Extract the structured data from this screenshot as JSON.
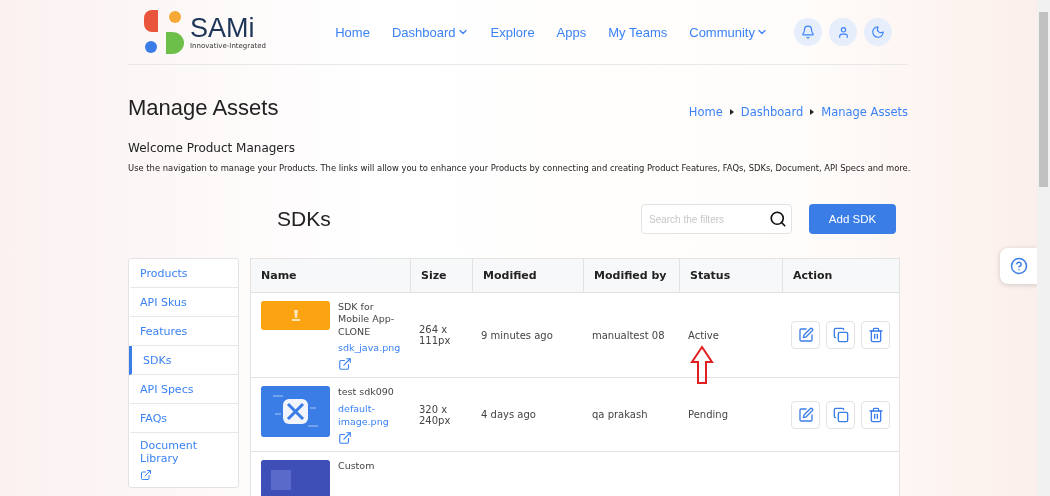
{
  "header": {
    "logo_name": "SAMi",
    "logo_tagline": "Innovative-Integrated",
    "nav": [
      {
        "label": "Home",
        "dropdown": false
      },
      {
        "label": "Dashboard",
        "dropdown": true
      },
      {
        "label": "Explore",
        "dropdown": false
      },
      {
        "label": "Apps",
        "dropdown": false
      },
      {
        "label": "My Teams",
        "dropdown": false
      },
      {
        "label": "Community",
        "dropdown": true
      }
    ]
  },
  "page": {
    "title": "Manage Assets",
    "breadcrumbs": [
      "Home",
      "Dashboard",
      "Manage Assets"
    ],
    "welcome": "Welcome Product Managers",
    "description": "Use the navigation to manage your Products. The links will allow you to enhance your Products by connecting and creating Product Features, FAQs, SDKs, Document, API Specs and more."
  },
  "section": {
    "title": "SDKs",
    "search": {
      "placeholder": "Search the filters"
    },
    "add_button": "Add SDK"
  },
  "sidebar": {
    "items": [
      {
        "label": "Products",
        "selected": false,
        "external": false
      },
      {
        "label": "API Skus",
        "selected": false,
        "external": false
      },
      {
        "label": "Features",
        "selected": false,
        "external": false
      },
      {
        "label": "SDKs",
        "selected": true,
        "external": false
      },
      {
        "label": "API Specs",
        "selected": false,
        "external": false
      },
      {
        "label": "FAQs",
        "selected": false,
        "external": false
      },
      {
        "label": "Document Library",
        "selected": false,
        "external": true
      }
    ]
  },
  "table": {
    "columns": [
      "Name",
      "Size",
      "Modified",
      "Modified by",
      "Status",
      "Action"
    ],
    "rows": [
      {
        "name": "SDK for Mobile App-CLONE",
        "file": "sdk_java.png",
        "size": "264 x 111px",
        "modified": "9 minutes ago",
        "modified_by": "manualtest 08",
        "status": "Active",
        "highlighted": true
      },
      {
        "name": "test sdk090",
        "file": "default-image.png",
        "size": "320 x 240px",
        "modified": "4 days ago",
        "modified_by": "qa prakash",
        "status": "Pending",
        "highlighted": false
      },
      {
        "name": "Custom",
        "highlighted": false
      }
    ]
  }
}
